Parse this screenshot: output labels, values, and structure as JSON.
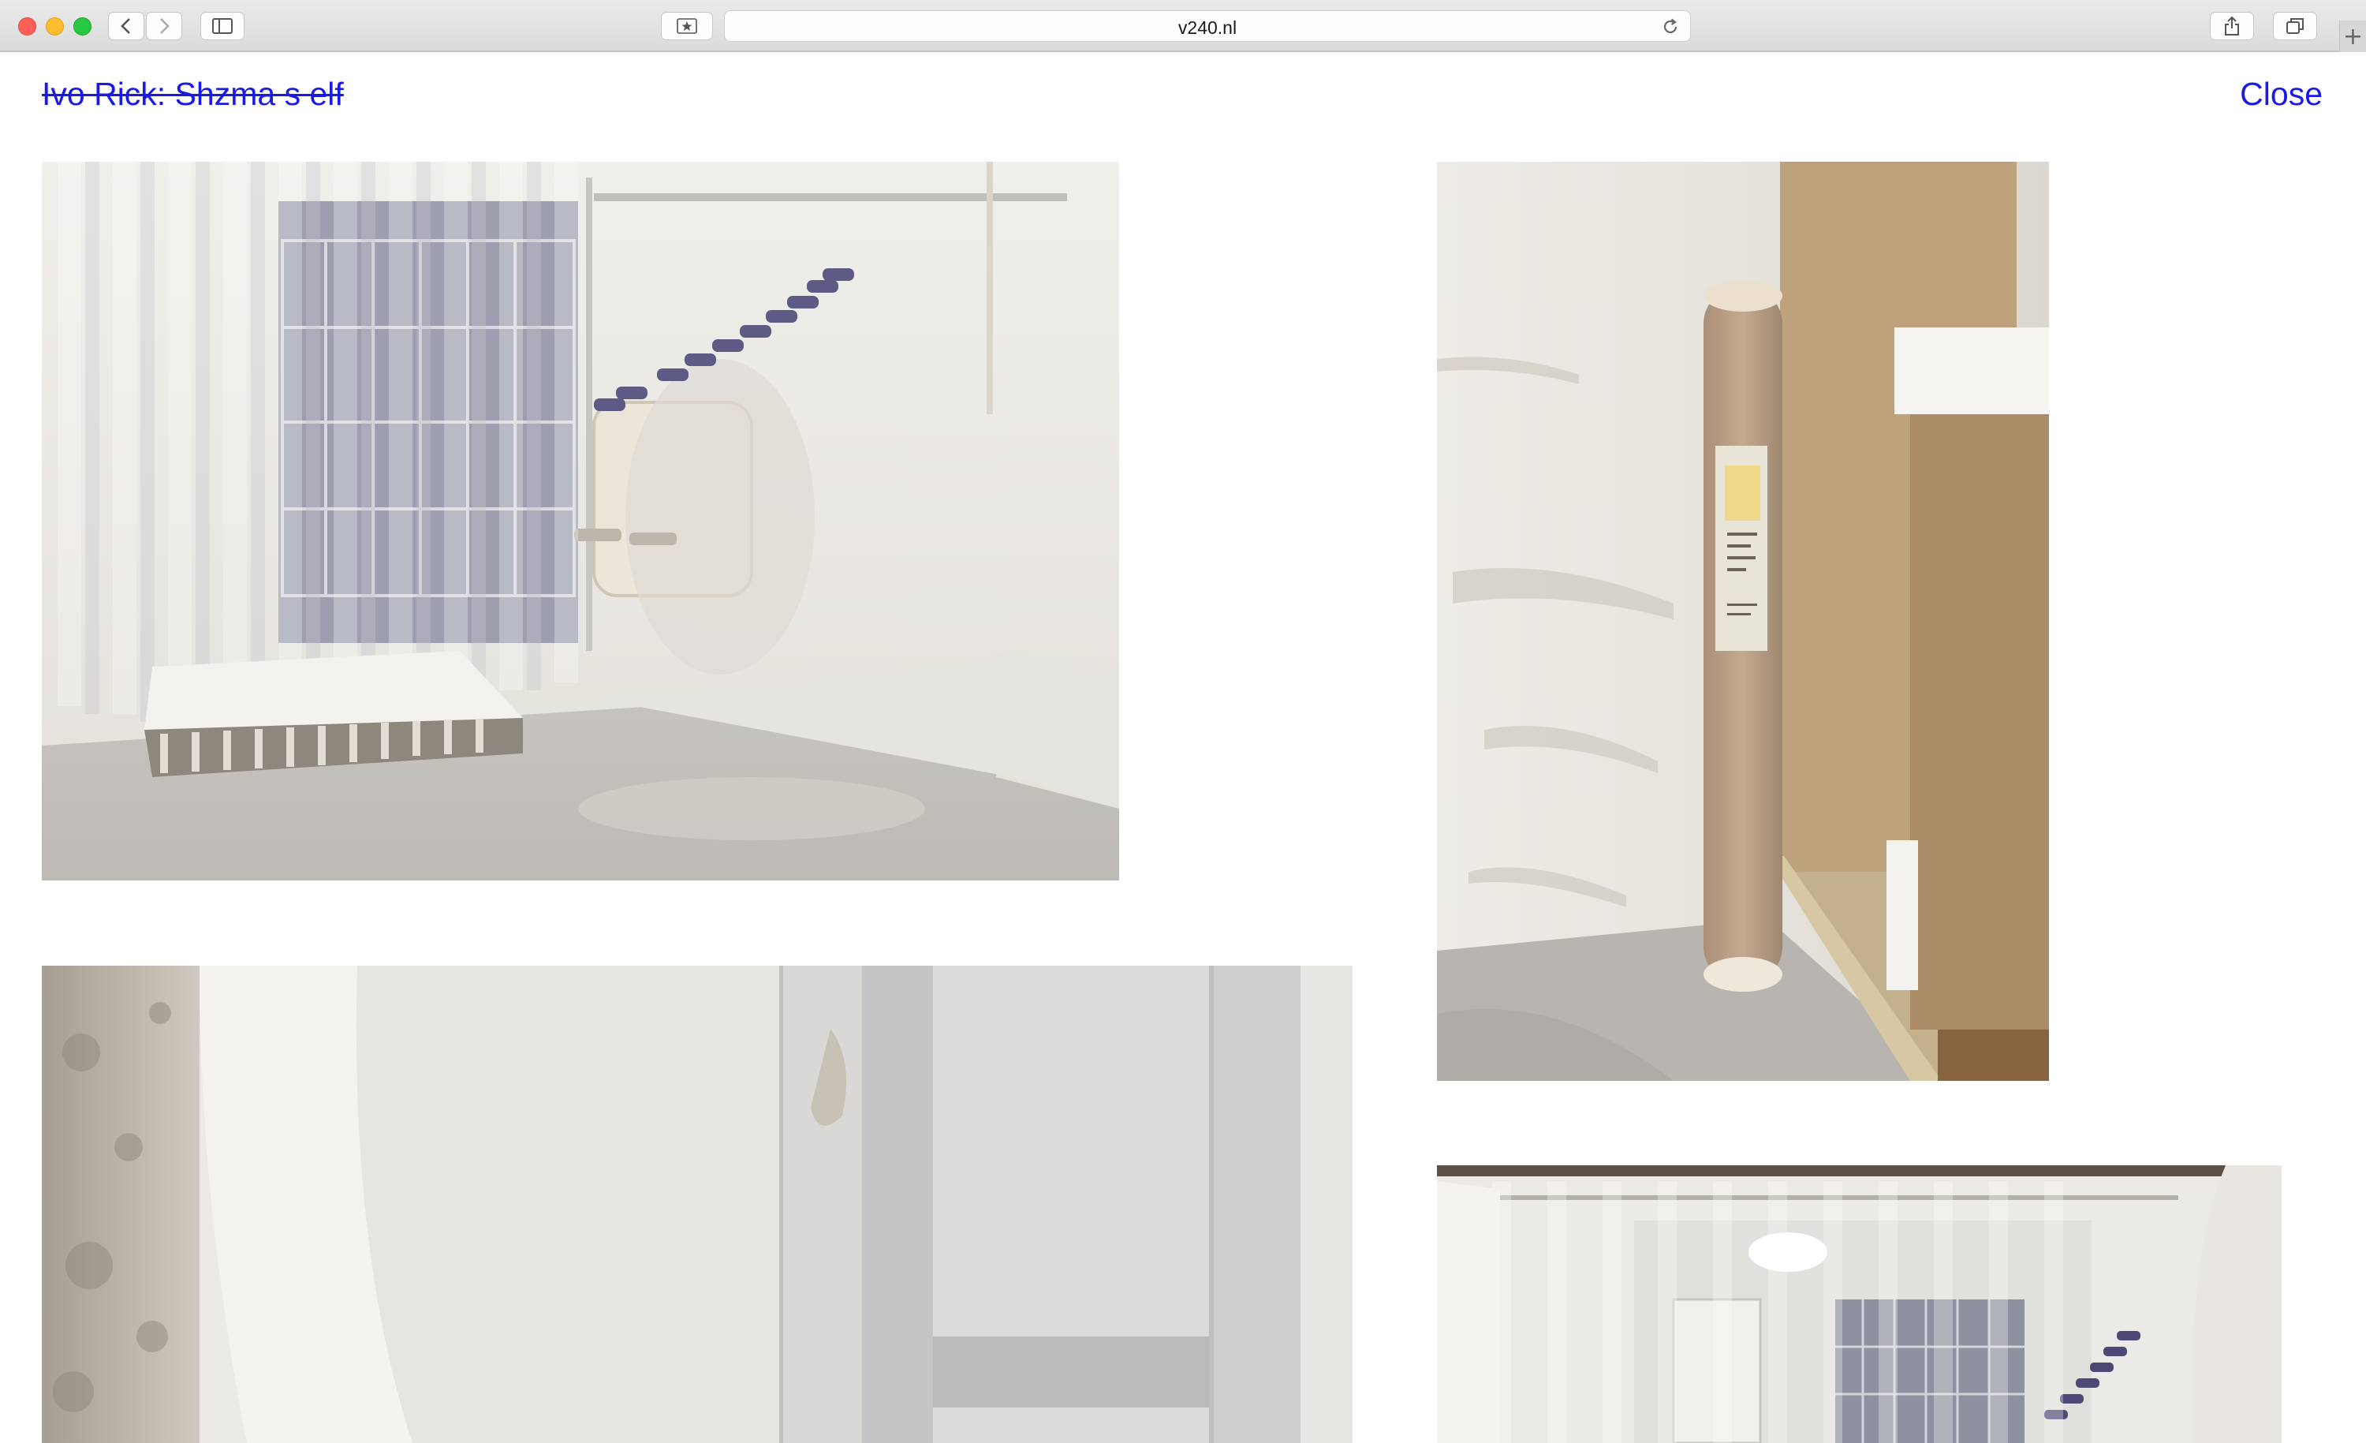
{
  "browser": {
    "url": "v240.nl",
    "icons": {
      "back": "chevron-left-icon",
      "forward": "chevron-right-icon",
      "sidebar": "sidebar-icon",
      "bookmark": "star-icon",
      "reload": "reload-icon",
      "share": "share-icon",
      "tabs": "tabs-icon",
      "new_tab": "plus-icon"
    },
    "new_tab_glyph": "+"
  },
  "page": {
    "title": "Ivo Rick: Shzma s elf",
    "close_label": "Close",
    "link_color": "#1a1ae6"
  },
  "gallery": {
    "images": [
      {
        "subject": "installation-room-curtain-window"
      },
      {
        "subject": "corner-cardboard-tube"
      },
      {
        "subject": "closeup-plastic-panels"
      },
      {
        "subject": "corridor-strip-curtain"
      }
    ]
  }
}
